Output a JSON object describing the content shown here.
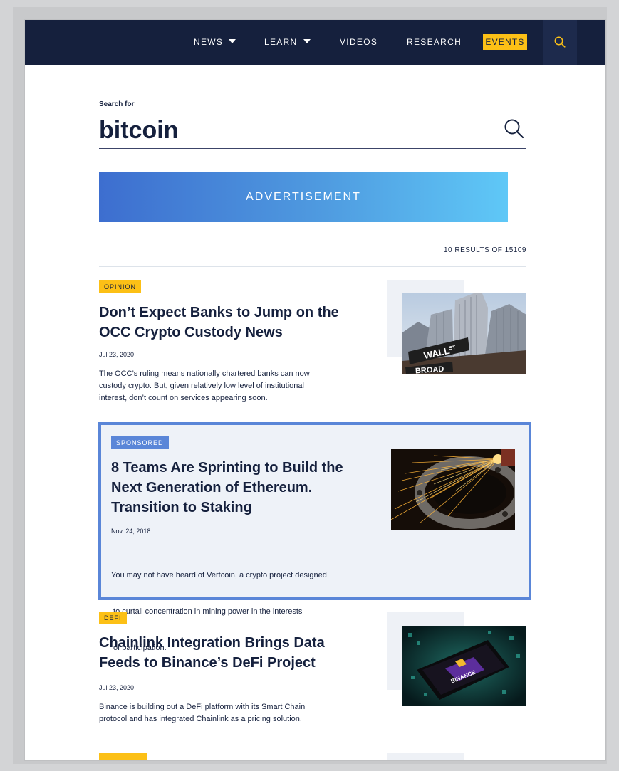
{
  "nav": {
    "items": [
      "NEWS",
      "LEARN",
      "VIDEOS",
      "RESEARCH"
    ],
    "events_label": "EVENTS"
  },
  "search": {
    "label": "Search for",
    "query": "bitcoin"
  },
  "ad": {
    "label": "ADVERTISEMENT"
  },
  "results": {
    "count_text": "10 RESULTS OF 15109"
  },
  "articles": [
    {
      "tag": "OPINION",
      "title_line1": "Don’t Expect Banks to Jump on the",
      "title_line2": "OCC Crypto Custody News",
      "date": "Jul 23, 2020",
      "summary_line1": "The OCC’s ruling means nationally chartered banks can now",
      "summary_line2": "custody crypto. But, given relatively low level of institutional",
      "summary_line3": "interest, don’t count on services appearing soon.",
      "image_sign1": "WALL",
      "image_sign1_sup": "ST",
      "image_sign2": "BROAD"
    },
    {
      "tag": "SPONSORED",
      "title_line1": "8 Teams Are Sprinting to Build the",
      "title_line2": "Next Generation of Ethereum.",
      "title_line3": "Transition to Staking",
      "date": "Nov. 24, 2018",
      "summary_line1": "You may not have heard of Vertcoin, a crypto project designed",
      "summary_line2": " to curtail concentration in mining power in the interests",
      "summary_line3": " of participation."
    },
    {
      "tag": "DEFI",
      "title_line1": "Chainlink Integration Brings Data",
      "title_line2": "Feeds to Binance’s DeFi Project",
      "date": "Jul 23, 2020",
      "summary_line1": "Binance is building out a DeFi platform with its Smart Chain",
      "summary_line2": "protocol and has integrated Chainlink as a pricing solution.",
      "image_text": "BINANCE"
    }
  ],
  "colors": {
    "navy": "#15203d",
    "yellow": "#fcc016",
    "sponsored_blue": "#5a86d8"
  }
}
